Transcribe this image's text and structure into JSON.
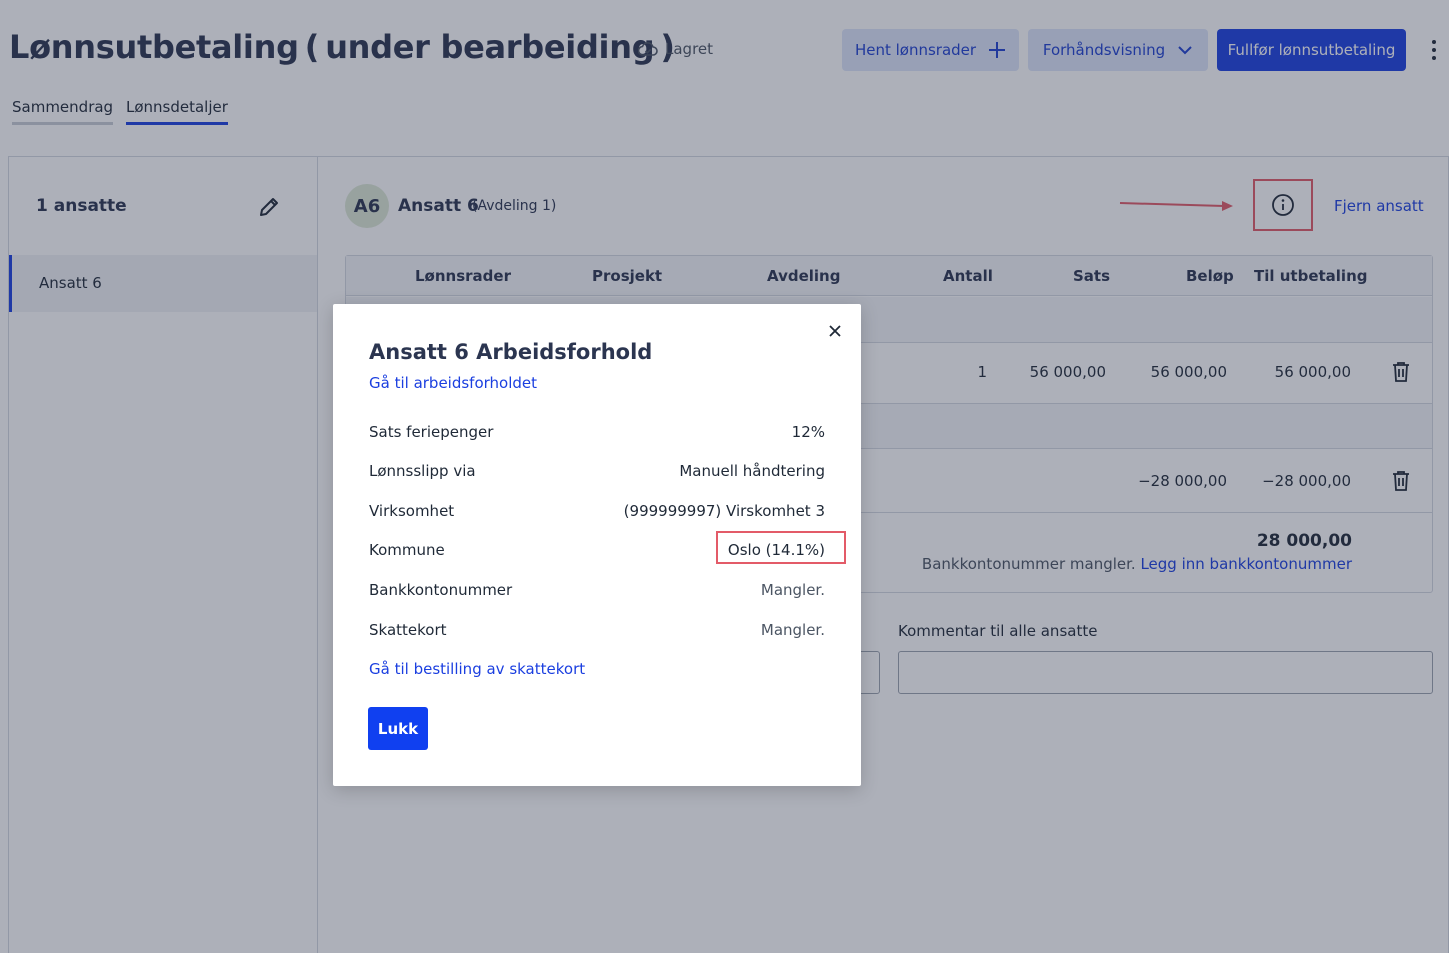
{
  "header": {
    "title": "Lønnsutbetaling ( under bearbeiding )",
    "saved_status": "Lagret",
    "buttons": {
      "fetch_rows": "Hent lønnsrader",
      "preview": "Forhåndsvisning",
      "complete": "Fullfør lønnsutbetaling"
    }
  },
  "tabs": [
    {
      "label": "Sammendrag",
      "active": false
    },
    {
      "label": "Lønnsdetaljer",
      "active": true
    }
  ],
  "sidebar": {
    "count_label": "1 ansatte",
    "items": [
      {
        "label": "Ansatt 6",
        "selected": true
      }
    ]
  },
  "employee": {
    "initials": "A6",
    "name": "Ansatt 6",
    "department": "(Avdeling 1)",
    "remove_label": "Fjern ansatt"
  },
  "table": {
    "columns": [
      "Lønnsrader",
      "Prosjekt",
      "Avdeling",
      "Antall",
      "Sats",
      "Beløp",
      "Til utbetaling"
    ],
    "rows": [
      {
        "antall": "1",
        "sats": "56 000,00",
        "belop": "56 000,00",
        "til_utbetaling": "56 000,00"
      },
      {
        "antall": "",
        "sats": "",
        "belop": "−28 000,00",
        "til_utbetaling": "−28 000,00"
      }
    ],
    "total": "28 000,00",
    "bank_missing_text": "Bankkontonummer mangler.",
    "bank_missing_link": "Legg inn bankkontonummer"
  },
  "comment": {
    "label": "Kommentar til alle ansatte",
    "value": ""
  },
  "modal": {
    "title": "Ansatt 6 Arbeidsforhold",
    "employment_link": "Gå til arbeidsforholdet",
    "fields": [
      {
        "label": "Sats feriepenger",
        "value": "12%"
      },
      {
        "label": "Lønnsslipp via",
        "value": "Manuell håndtering"
      },
      {
        "label": "Virksomhet",
        "value": "(999999997) Virskomhet 3"
      },
      {
        "label": "Kommune",
        "value": "Oslo (14.1%)"
      },
      {
        "label": "Bankkontonummer",
        "value": "Mangler."
      },
      {
        "label": "Skattekort",
        "value": "Mangler."
      }
    ],
    "tax_card_link": "Gå til bestilling av skattekort",
    "close_label": "Lukk"
  },
  "colors": {
    "primary": "#1b3fe0",
    "highlight": "#e35b68",
    "overlay": "rgba(40,48,72,0.38)"
  },
  "icons": [
    "cloud-check-icon",
    "plus-icon",
    "chevron-down-icon",
    "kebab-menu-icon",
    "pencil-icon",
    "info-icon",
    "trash-icon",
    "close-icon",
    "arrow-right-icon"
  ]
}
